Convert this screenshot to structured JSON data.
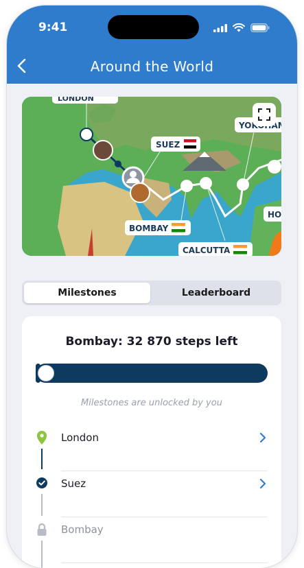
{
  "status_bar": {
    "time": "9:41"
  },
  "header": {
    "title": "Around the World"
  },
  "map": {
    "labels": [
      "LONDON",
      "SUEZ",
      "YOKOHAMA",
      "BOMBAY",
      "CALCUTTA",
      "HO"
    ]
  },
  "tabs": [
    {
      "label": "Milestones",
      "active": true
    },
    {
      "label": "Leaderboard",
      "active": false
    }
  ],
  "goal": {
    "text": "Bombay: 32 870 steps left"
  },
  "progress": {
    "fraction": 0.02
  },
  "hint": "Milestones are unlocked by you",
  "milestones": [
    {
      "name": "London",
      "state": "current"
    },
    {
      "name": "Suez",
      "state": "done"
    },
    {
      "name": "Bombay",
      "state": "locked"
    }
  ],
  "colors": {
    "header": "#2e7ccb",
    "progress": "#0d3a5e",
    "pin": "#8cc63f",
    "chevron": "#2e7ccb"
  }
}
